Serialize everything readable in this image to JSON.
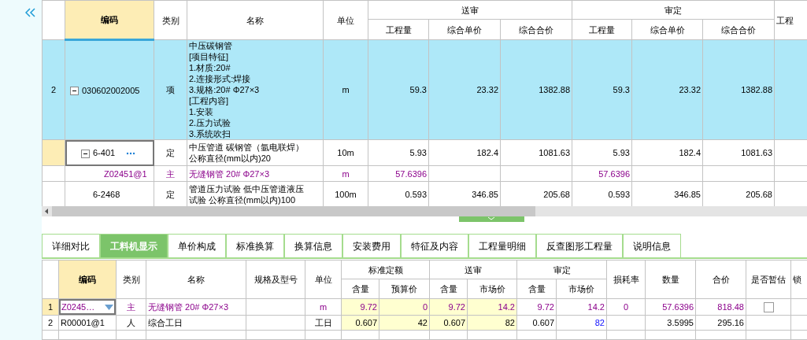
{
  "top_table": {
    "header": {
      "code": "编码",
      "type": "类别",
      "name": "名称",
      "unit": "单位",
      "groups": [
        {
          "label": "送审",
          "columns": [
            "工程量",
            "综合单价",
            "综合合价"
          ]
        },
        {
          "label": "审定",
          "columns": [
            "工程量",
            "综合单价",
            "综合合价"
          ]
        }
      ],
      "extra": "工程"
    },
    "rows": [
      {
        "number": "2",
        "code": "030602002005",
        "type": "项",
        "name_lines": [
          "中压碳钢管",
          "[项目特征]",
          "1.材质:20#",
          "2.连接形式:焊接",
          "3.规格:20# Φ27×3",
          "[工程内容]",
          "1.安装",
          "2.压力试验",
          "3.系统吹扫"
        ],
        "unit": "m",
        "submitted": {
          "quantity": "59.3",
          "unit_price": "23.32",
          "total": "1382.88"
        },
        "approved": {
          "quantity": "59.3",
          "unit_price": "23.32",
          "total": "1382.88"
        },
        "material": false,
        "selected": true,
        "expanded": true,
        "children": [
          {
            "code": "6-401",
            "type": "定",
            "name_lines": [
              "中压管道 碳钢管（氩电联焊）",
              "公称直径(mm以内)20"
            ],
            "unit": "10m",
            "submitted": {
              "quantity": "5.93",
              "unit_price": "182.4",
              "total": "1081.63"
            },
            "approved": {
              "quantity": "5.93",
              "unit_price": "182.4",
              "total": "1081.63"
            },
            "material": false,
            "selected": false,
            "focused": true,
            "expanded": true,
            "children": [
              {
                "code": "Z02451@1",
                "type": "主",
                "name_lines": [
                  "无缝钢管 20# Φ27×3"
                ],
                "unit": "m",
                "submitted": {
                  "quantity": "57.6396"
                },
                "approved": {
                  "quantity": "57.6396"
                },
                "material": true,
                "selected": false
              }
            ]
          },
          {
            "code": "6-2468",
            "type": "定",
            "name_lines": [
              "管道压力试验 低中压管道液压",
              "试验 公称直径(mm以内)100"
            ],
            "unit": "100m",
            "submitted": {
              "quantity": "0.593",
              "unit_price": "346.85",
              "total": "205.68"
            },
            "approved": {
              "quantity": "0.593",
              "unit_price": "346.85",
              "total": "205.68"
            },
            "material": false,
            "selected": false,
            "focused": false
          }
        ]
      }
    ]
  },
  "tabs": [
    {
      "label": "详细对比",
      "selected": false
    },
    {
      "label": "工料机显示",
      "selected": true
    },
    {
      "label": "单价构成",
      "selected": false
    },
    {
      "label": "标准换算",
      "selected": false
    },
    {
      "label": "换算信息",
      "selected": false
    },
    {
      "label": "安装费用",
      "selected": false
    },
    {
      "label": "特征及内容",
      "selected": false
    },
    {
      "label": "工程量明细",
      "selected": false
    },
    {
      "label": "反查图形工程量",
      "selected": false
    },
    {
      "label": "说明信息",
      "selected": false
    }
  ],
  "resource_table": {
    "header": {
      "code": "编码",
      "type": "类别",
      "name": "名称",
      "spec": "规格及型号",
      "unit": "单位",
      "groups": [
        {
          "label": "标准定额",
          "columns": [
            "含量",
            "预算价"
          ]
        },
        {
          "label": "送审",
          "columns": [
            "含量",
            "市场价"
          ]
        },
        {
          "label": "审定",
          "columns": [
            "含量",
            "市场价"
          ]
        }
      ],
      "loss": "损耗率",
      "quantity": "数量",
      "total": "合价",
      "provisional": "是否暂估",
      "extra": "锁"
    },
    "rows": [
      {
        "number": "1",
        "code": "Z0245…",
        "type": "主",
        "name": "无缝钢管 20# Φ27×3",
        "unit": "m",
        "values": [
          "9.72",
          "0",
          "9.72",
          "14.2",
          "9.72",
          "14.2"
        ],
        "loss": "0",
        "quantity": "57.6396",
        "total": "818.48",
        "provisional": false,
        "material": true,
        "selected": true,
        "price_modified": false
      },
      {
        "number": "2",
        "code": "R00001@1",
        "type": "人",
        "name": "综合工日",
        "unit": "工日",
        "values": [
          "0.607",
          "42",
          "0.607",
          "82",
          "0.607",
          "82"
        ],
        "quantity": "3.5995",
        "total": "295.16",
        "material": false,
        "selected": false,
        "price_modified": true
      }
    ]
  }
}
